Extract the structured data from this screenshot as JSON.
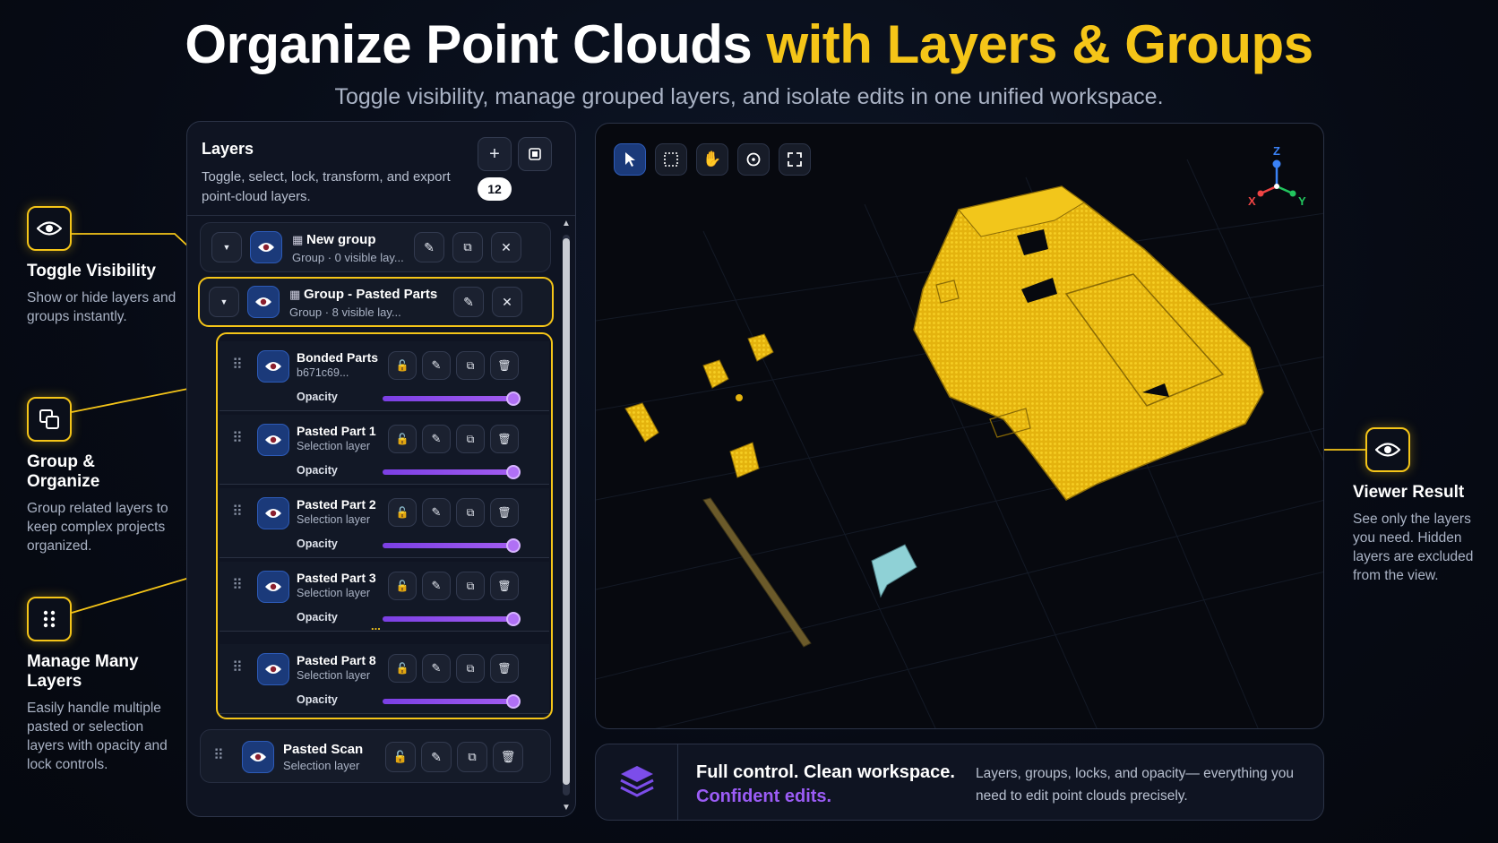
{
  "header": {
    "title_white": "Organize Point Clouds",
    "title_highlight": "with Layers & Groups",
    "subtitle": "Toggle visibility, manage grouped layers, and isolate edits in one unified workspace."
  },
  "callouts": {
    "toggle": {
      "title": "Toggle Visibility",
      "text": "Show or hide layers and groups instantly."
    },
    "group": {
      "title": "Group & Organize",
      "text": "Group related layers to keep complex projects organized."
    },
    "many": {
      "title": "Manage Many Layers",
      "text": "Easily handle multiple pasted or selection layers with opacity and lock controls."
    },
    "viewer": {
      "title": "Viewer Result",
      "text": "See only the layers you need. Hidden layers are excluded from the view."
    }
  },
  "panel": {
    "title": "Layers",
    "description": "Toggle, select, lock, transform, and export point-cloud layers.",
    "count": "12",
    "add_label": "+",
    "groups": [
      {
        "name": "New group",
        "meta": "Group · 0 visible lay..."
      },
      {
        "name": "Group - Pasted Parts",
        "meta": "Group · 8 visible lay..."
      }
    ],
    "opacity_label": "Opacity",
    "layers": [
      {
        "name": "Bonded Parts",
        "sub": "b671c69...",
        "opacity": 1.0
      },
      {
        "name": "Pasted Part 1",
        "sub": "Selection layer",
        "opacity": 1.0
      },
      {
        "name": "Pasted Part 2",
        "sub": "Selection layer",
        "opacity": 1.0
      },
      {
        "name": "Pasted Part 3",
        "sub": "Selection layer",
        "opacity": 1.0
      },
      {
        "name": "Pasted Part 8",
        "sub": "Selection layer",
        "opacity": 1.0
      }
    ],
    "ellipsis": "...",
    "standalone": {
      "name": "Pasted Scan",
      "sub": "Selection layer"
    }
  },
  "viewer": {
    "tools": [
      "pointer-icon",
      "marquee-select-icon",
      "pan-hand-icon",
      "orbit-icon",
      "fullscreen-icon"
    ],
    "axes": {
      "z": "Z",
      "x": "X",
      "y": "Y"
    },
    "colors": {
      "accent": "#f5c518",
      "cloud": "#e8b90f",
      "eye_button": "#1b3a7a",
      "opacity": "#a25cf0"
    }
  },
  "infobar": {
    "headline": "Full control. Clean workspace.",
    "headline_accent": "Confident edits.",
    "description": "Layers, groups, locks, and opacity— everything you need to edit point clouds precisely."
  }
}
